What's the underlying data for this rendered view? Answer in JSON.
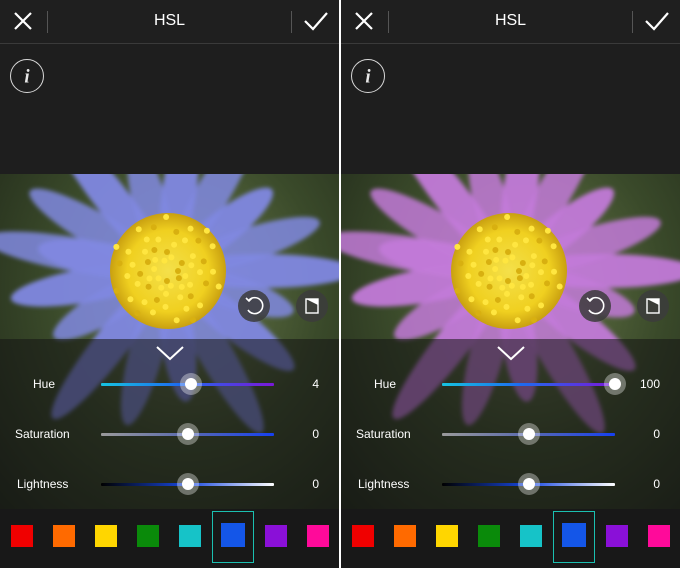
{
  "panels": [
    {
      "title": "HSL",
      "sliders": [
        {
          "label": "Hue",
          "value": "4",
          "level": 0.52
        },
        {
          "label": "Saturation",
          "value": "0",
          "level": 0.5
        },
        {
          "label": "Lightness",
          "value": "0",
          "level": 0.5
        }
      ],
      "petal_color": "#8088e0"
    },
    {
      "title": "HSL",
      "sliders": [
        {
          "label": "Hue",
          "value": "100",
          "level": 1.0
        },
        {
          "label": "Saturation",
          "value": "0",
          "level": 0.5
        },
        {
          "label": "Lightness",
          "value": "0",
          "level": 0.5
        }
      ],
      "petal_color": "#c27ad8"
    }
  ],
  "swatches": [
    "#f00000",
    "#ff6a00",
    "#ffd600",
    "#0a8a0a",
    "#16c3c8",
    "#1456e8",
    "#8a10d8",
    "#ff0a9a"
  ],
  "selected_swatch": 5,
  "colors": {
    "accent": "#1bbfb0",
    "background": "#1e1e1e"
  }
}
